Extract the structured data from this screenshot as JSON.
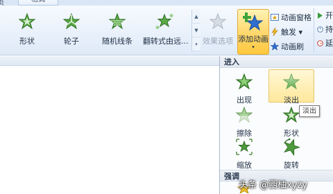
{
  "tabs": {
    "left": "页",
    "active": "格式"
  },
  "animation_gallery": {
    "items": [
      {
        "label": "形状",
        "icon": "shape-star-icon"
      },
      {
        "label": "轮子",
        "icon": "wheel-star-icon"
      },
      {
        "label": "随机线条",
        "icon": "random-lines-star-icon"
      },
      {
        "label": "翻转式由远...",
        "icon": "flip-star-icon"
      }
    ],
    "scroll": {
      "up": "▲",
      "down": "▼",
      "more": "▾"
    }
  },
  "effect_options": {
    "label": "效果选项"
  },
  "add_animation": {
    "label": "添加动画",
    "arrow": "▾"
  },
  "side_buttons": {
    "animation_pane": "动画窗格",
    "trigger": "触发 ▾",
    "animation_painter": "动画刷"
  },
  "right_column": [
    "开",
    "持",
    "延"
  ],
  "dropdown": {
    "section_enter": "进入",
    "section_emphasis": "强调",
    "items": [
      {
        "label": "出现",
        "icon": "appear-star-icon"
      },
      {
        "label": "淡出",
        "icon": "fade-star-icon"
      },
      {
        "label": "擦除",
        "icon": "wipe-star-icon"
      },
      {
        "label": "形状",
        "icon": "shape-star-icon"
      },
      {
        "label": "缩放",
        "icon": "zoom-star-icon"
      },
      {
        "label": "旋转",
        "icon": "spin-star-icon"
      }
    ],
    "tooltip": "淡出"
  },
  "watermark": "头条 @西柚xyzy",
  "colors": {
    "star_green": "#4e9b3c",
    "highlight": "#ffe89c",
    "ribbon": "#e9f1fb"
  }
}
